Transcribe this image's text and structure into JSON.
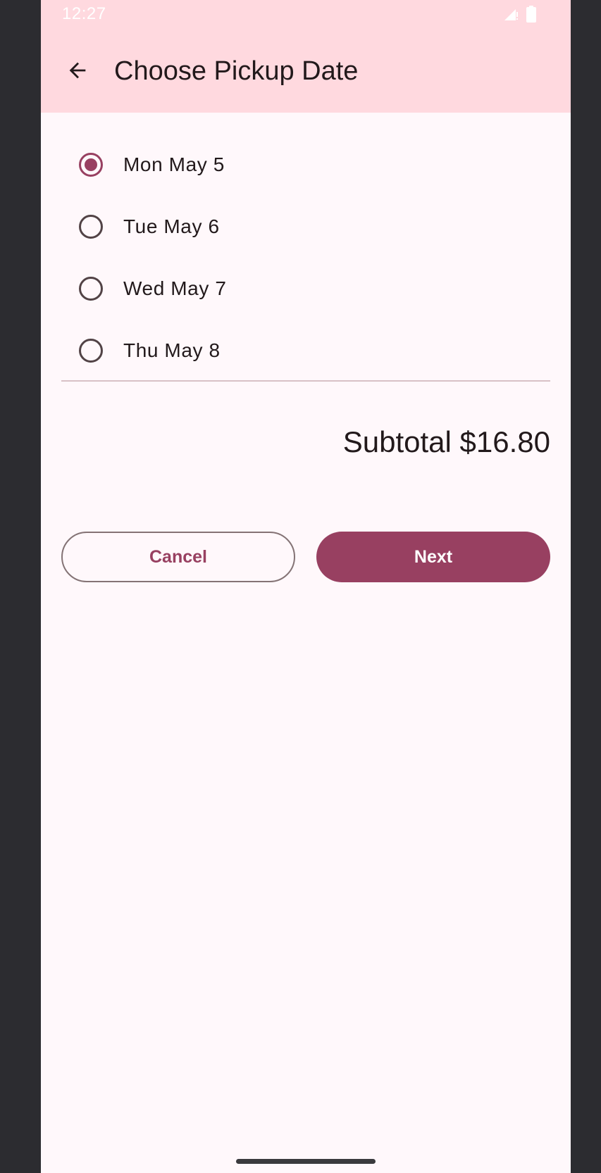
{
  "status_bar": {
    "time": "12:27",
    "icons": [
      "signal-icon",
      "battery-icon"
    ]
  },
  "app_bar": {
    "back_icon": "arrow-back-icon",
    "title": "Choose Pickup Date"
  },
  "pickup_options": [
    {
      "label": "Mon May 5",
      "selected": true
    },
    {
      "label": "Tue May 6",
      "selected": false
    },
    {
      "label": "Wed May 7",
      "selected": false
    },
    {
      "label": "Thu May 8",
      "selected": false
    }
  ],
  "summary": {
    "subtotal": "Subtotal $16.80"
  },
  "actions": {
    "cancel_label": "Cancel",
    "next_label": "Next"
  },
  "colors": {
    "primary": "#984061",
    "app_bar_bg": "#ffd9df",
    "surface": "#fff8fb",
    "on_surface": "#22191b",
    "outline": "#847375"
  }
}
